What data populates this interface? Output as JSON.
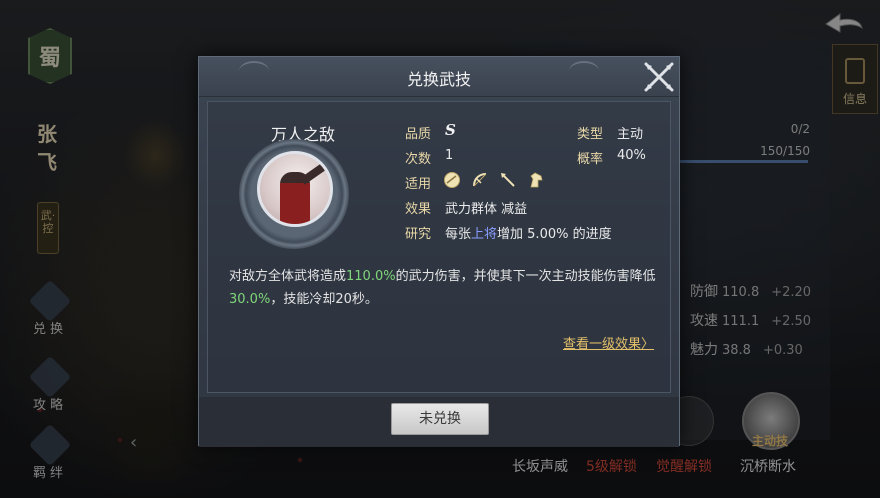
{
  "general": {
    "faction": "蜀",
    "name": "张飞",
    "role": "武·控"
  },
  "side_menu": [
    {
      "label": "兑换"
    },
    {
      "label": "攻略"
    },
    {
      "label": "羁绊"
    }
  ],
  "right_panel": {
    "count_a": "0/2",
    "count_b": "150/150",
    "stats": [
      {
        "label": "防御",
        "value": "110.8",
        "bonus": "+2.20"
      },
      {
        "label": "攻速",
        "value": "111.1",
        "bonus": "+2.50"
      },
      {
        "label": "魅力",
        "value": "38.8",
        "bonus": "+0.30"
      }
    ],
    "info_label": "信息",
    "bottom_skills": [
      {
        "label": "长坂声威",
        "color": "#e6e6e6"
      },
      {
        "label": "5级解锁",
        "color": "#d44a3a"
      },
      {
        "label": "觉醒解锁",
        "color": "#d44a3a"
      },
      {
        "label": "沉桥断水",
        "color": "#e6e6e6"
      }
    ],
    "orb_tag": "主动技"
  },
  "dialog": {
    "title": "兑换武技",
    "skill_name": "万人之敌",
    "attributes": {
      "quality_label": "品质",
      "quality_value": "S",
      "type_label": "类型",
      "type_value": "主动",
      "uses_label": "次数",
      "uses_value": "1",
      "rate_label": "概率",
      "rate_value": "40%",
      "applies_label": "适用",
      "applies_icons": [
        "shield-icon",
        "bow-icon",
        "spear-icon",
        "horse-icon"
      ],
      "effect_label": "效果",
      "effect_value": "武力群体 减益",
      "research_label": "研究",
      "research_prefix": "每张",
      "research_highlight": "上将",
      "research_suffix": "增加 5.00% 的进度"
    },
    "description": {
      "part1": "对敌方全体武将造成",
      "num1": "110.0%",
      "part2": "的武力伤害，并使其下一次主动技能伤害降低",
      "num2": "30.0%",
      "part3": "，技能冷却20秒。"
    },
    "view_link": "查看一级效果〉",
    "button_label": "未兑换"
  },
  "colors": {
    "accent_gold": "#e4c06a",
    "highlight_green": "#7fd67a",
    "highlight_blue": "#8a9cff",
    "locked_red": "#d44a3a"
  }
}
